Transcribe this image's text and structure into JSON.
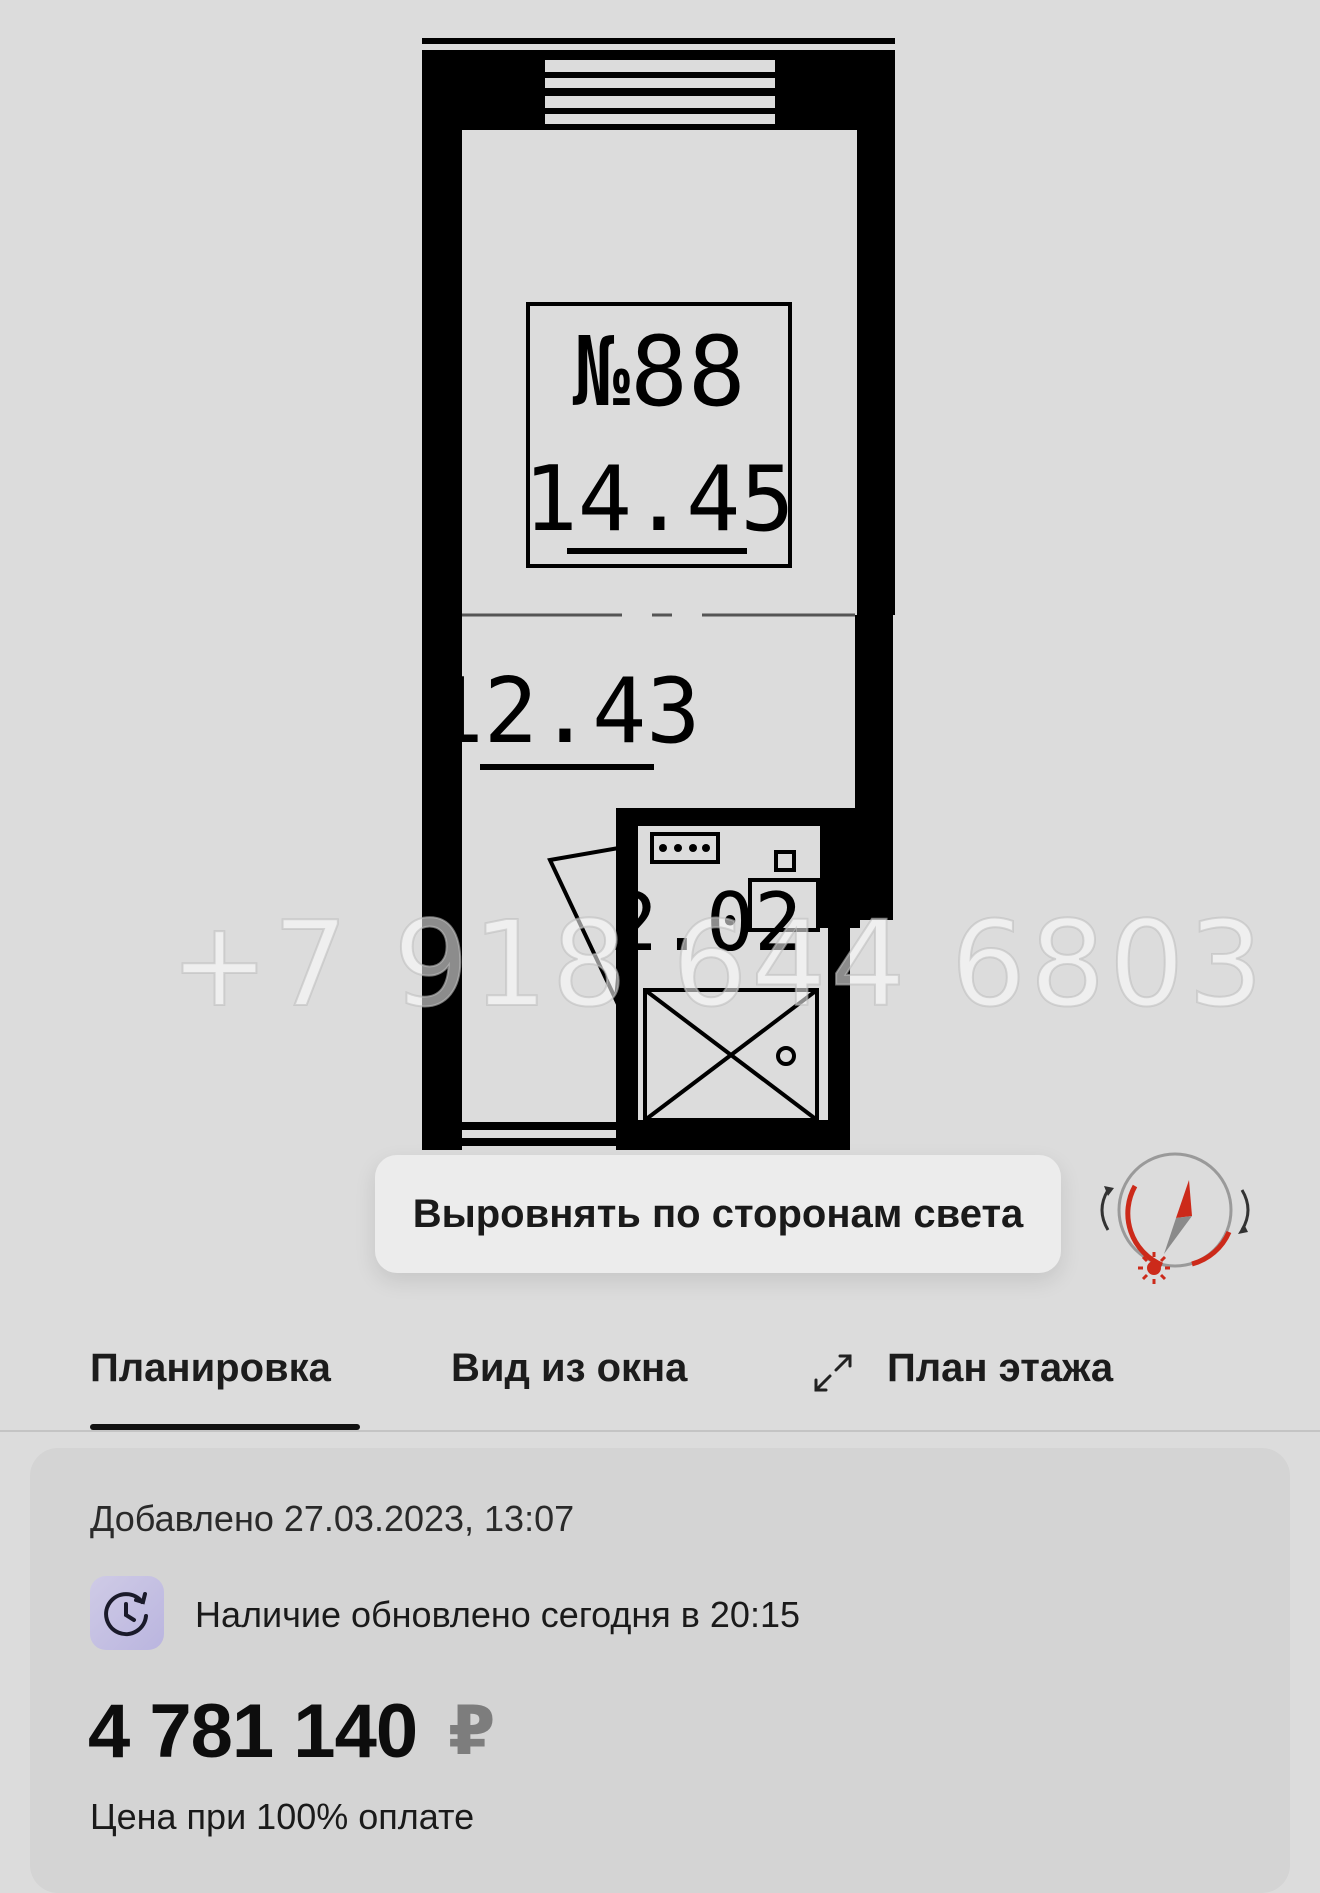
{
  "floor_plan": {
    "apartment_number": "№88",
    "room_area": "14.45",
    "corridor_area": "12.43",
    "bathroom_area": "2.02"
  },
  "watermark": "+7 918 644 6803",
  "orientation_button": {
    "label": "Выровнять по сторонам света"
  },
  "compass": {
    "icon": "compass-icon",
    "accent_color": "#cc2a1a"
  },
  "tabs": [
    {
      "label": "Планировка",
      "active": true
    },
    {
      "label": "Вид из окна",
      "active": false
    },
    {
      "label": "План этажа",
      "active": false,
      "icon": "expand-icon"
    }
  ],
  "info": {
    "added": "Добавлено 27.03.2023, 13:07",
    "availability": "Наличие обновлено сегодня в 20:15",
    "availability_icon": "clock-refresh-icon",
    "price": "4 781 140",
    "currency": "₽",
    "price_note": "Цена при 100% оплате"
  }
}
